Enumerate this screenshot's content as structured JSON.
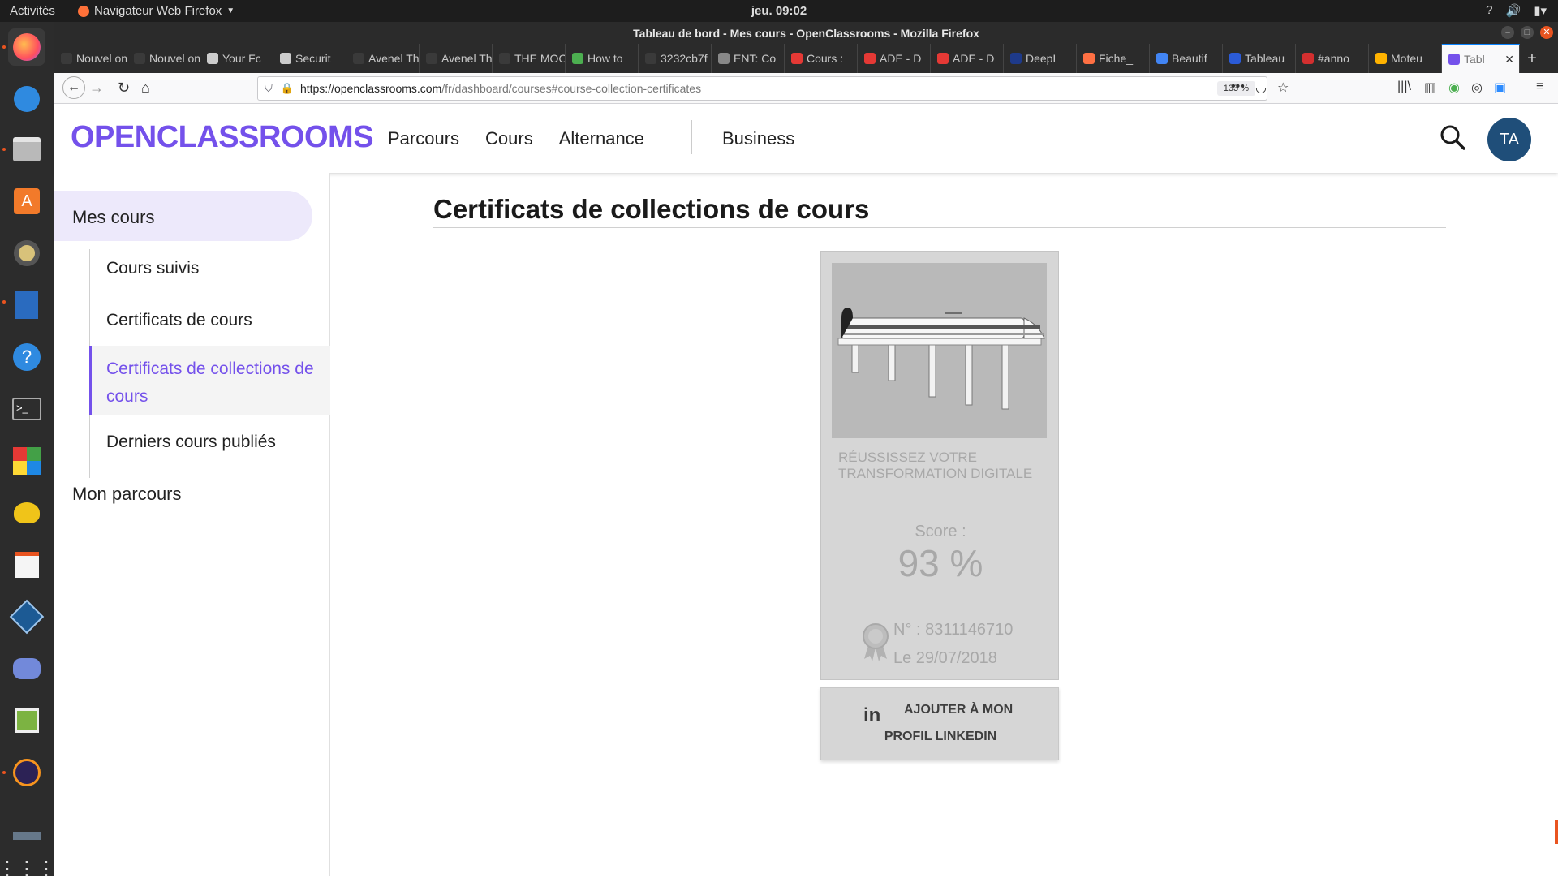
{
  "system": {
    "activities": "Activités",
    "app_name": "Navigateur Web Firefox",
    "clock": "jeu. 09:02"
  },
  "window": {
    "title": "Tableau de bord - Mes cours - OpenClassrooms - Mozilla Firefox"
  },
  "tabs": [
    {
      "label": "Nouvel on",
      "color": "#3a3a3a"
    },
    {
      "label": "Nouvel on",
      "color": "#3a3a3a"
    },
    {
      "label": "Your Fc",
      "color": "#cccccc"
    },
    {
      "label": "Securit",
      "color": "#cccccc"
    },
    {
      "label": "Avenel Th",
      "color": "#3a3a3a"
    },
    {
      "label": "Avenel Th",
      "color": "#3a3a3a"
    },
    {
      "label": "THE MOO",
      "color": "#3a3a3a"
    },
    {
      "label": "How to",
      "color": "#4caf50"
    },
    {
      "label": "3232cb7f",
      "color": "#3a3a3a"
    },
    {
      "label": "ENT: Co",
      "color": "#888888"
    },
    {
      "label": "Cours :",
      "color": "#e53935"
    },
    {
      "label": "ADE - D",
      "color": "#e53935"
    },
    {
      "label": "ADE - D",
      "color": "#e53935"
    },
    {
      "label": "DeepL",
      "color": "#1e3a8a"
    },
    {
      "label": "Fiche_",
      "color": "#ff7043"
    },
    {
      "label": "Beautif",
      "color": "#4285f4"
    },
    {
      "label": "Tableau",
      "color": "#2b5bd7"
    },
    {
      "label": "#anno",
      "color": "#d32f2f"
    },
    {
      "label": "Moteu",
      "color": "#ffb300"
    },
    {
      "label": "Tabl",
      "color": "#7451eb",
      "active": true
    }
  ],
  "url": {
    "host": "https://openclassrooms.com",
    "path": "/fr/dashboard/courses#course-collection-certificates",
    "zoom": "133 %"
  },
  "site": {
    "logo": "OPENCLASSROOMS",
    "nav": [
      "Parcours",
      "Cours",
      "Alternance"
    ],
    "business": "Business",
    "avatar": "TA"
  },
  "sidebar": {
    "mes_cours": "Mes cours",
    "items": [
      {
        "label": "Cours suivis"
      },
      {
        "label": "Certificats de cours"
      },
      {
        "label": "Certificats de collections de cours",
        "active": true
      },
      {
        "label": "Derniers cours publiés"
      }
    ],
    "mon_parcours": "Mon parcours"
  },
  "main": {
    "title": "Certificats de collections de cours",
    "certificate": {
      "name": "Réussissez votre transformation digitale",
      "score_label": "Score :",
      "score": "93 %",
      "number": "N° : 8311146710",
      "date": "Le 29/07/2018"
    },
    "linkedin": {
      "icon_text": "in",
      "line1": "AJOUTER À MON",
      "line2": "PROFIL LINKEDIN"
    }
  },
  "colors": {
    "brand": "#7451eb",
    "sidebar_active_bg": "#ede9fb",
    "avatar_bg": "#1f4e79"
  }
}
